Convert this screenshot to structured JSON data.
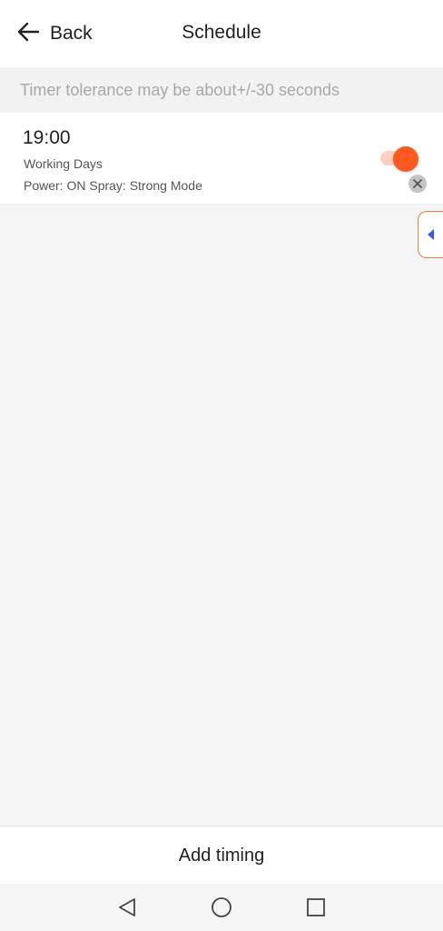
{
  "header": {
    "back_label": "Back",
    "title": "Schedule"
  },
  "notice": "Timer tolerance may be about+/-30 seconds",
  "schedules": [
    {
      "time": "19:00",
      "repeat": "Working Days",
      "action": "Power: ON Spray: Strong Mode",
      "enabled": true
    }
  ],
  "footer": {
    "add_label": "Add timing"
  },
  "colors": {
    "accent": "#ff5a1f",
    "toggle_track": "#ffd0bf",
    "side_tab_border": "#f07a40",
    "side_tab_arrow": "#3b5bdb"
  },
  "icons": {
    "back": "arrow-left-icon",
    "delete": "close-icon",
    "side_tab": "caret-left-icon",
    "nav_back": "triangle-back-icon",
    "nav_home": "circle-home-icon",
    "nav_recents": "square-recents-icon"
  }
}
